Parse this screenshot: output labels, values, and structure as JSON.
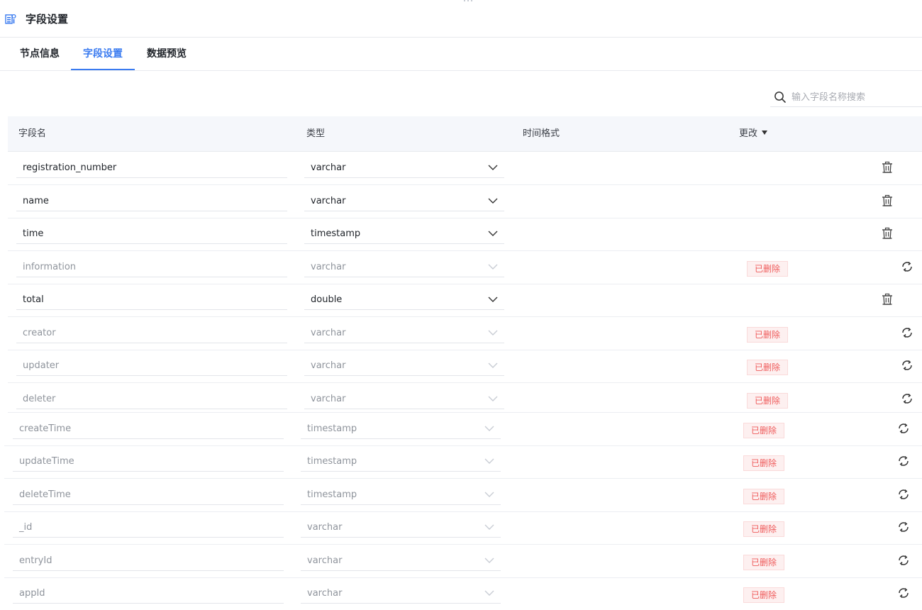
{
  "header": {
    "title": "字段设置",
    "icon": "field-settings-icon"
  },
  "tabs": [
    {
      "label": "节点信息",
      "active": false
    },
    {
      "label": "字段设置",
      "active": true
    },
    {
      "label": "数据预览",
      "active": false
    }
  ],
  "search": {
    "placeholder": "输入字段名称搜索",
    "value": ""
  },
  "table": {
    "columns": [
      "字段名",
      "类型",
      "时间格式",
      "更改"
    ],
    "rows": [
      {
        "name": "registration_number",
        "type": "varchar",
        "time_format": "",
        "status": "",
        "deleted": false
      },
      {
        "name": "name",
        "type": "varchar",
        "time_format": "",
        "status": "",
        "deleted": false
      },
      {
        "name": "time",
        "type": "timestamp",
        "time_format": "",
        "status": "",
        "deleted": false
      },
      {
        "name": "information",
        "type": "varchar",
        "time_format": "",
        "status": "已删除",
        "deleted": true
      },
      {
        "name": "total",
        "type": "double",
        "time_format": "",
        "status": "",
        "deleted": false
      },
      {
        "name": "creator",
        "type": "varchar",
        "time_format": "",
        "status": "已删除",
        "deleted": true
      },
      {
        "name": "updater",
        "type": "varchar",
        "time_format": "",
        "status": "已删除",
        "deleted": true
      },
      {
        "name": "deleter",
        "type": "varchar",
        "time_format": "",
        "status": "已删除",
        "deleted": true
      },
      {
        "name": "createTime",
        "type": "timestamp",
        "time_format": "",
        "status": "已删除",
        "deleted": true
      },
      {
        "name": "updateTime",
        "type": "timestamp",
        "time_format": "",
        "status": "已删除",
        "deleted": true
      },
      {
        "name": "deleteTime",
        "type": "timestamp",
        "time_format": "",
        "status": "已删除",
        "deleted": true
      },
      {
        "name": "_id",
        "type": "varchar",
        "time_format": "",
        "status": "已删除",
        "deleted": true
      },
      {
        "name": "entryId",
        "type": "varchar",
        "time_format": "",
        "status": "已删除",
        "deleted": true
      },
      {
        "name": "appId",
        "type": "varchar",
        "time_format": "",
        "status": "已删除",
        "deleted": true
      }
    ]
  },
  "colors": {
    "accent": "#3a7bf0",
    "deleted_text": "#ef5b5b",
    "deleted_bg": "#fdf0f0",
    "muted_text": "#8f949c",
    "header_bg": "#f5f7fb"
  },
  "icons": {
    "delete": "trash-icon",
    "restore": "restore-icon",
    "dropdown": "chevron-down-icon",
    "search": "search-icon"
  }
}
